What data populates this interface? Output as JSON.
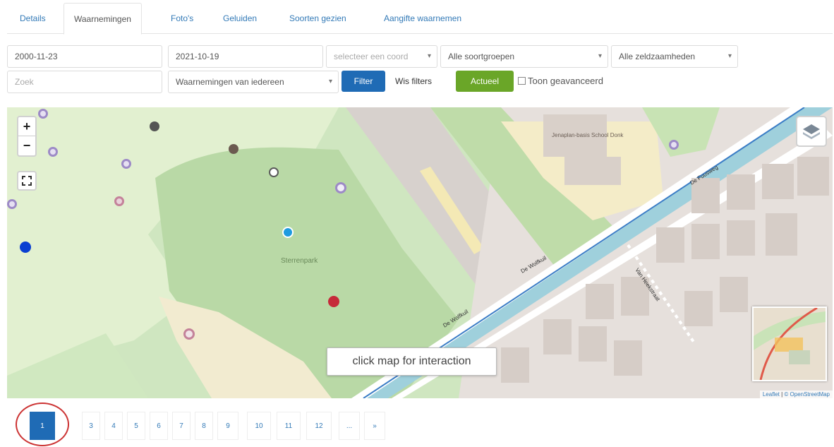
{
  "tabs": [
    {
      "label": "Details"
    },
    {
      "label": "Waarnemingen"
    },
    {
      "label": "Foto's"
    },
    {
      "label": "Geluiden"
    },
    {
      "label": "Soorten gezien"
    },
    {
      "label": "Aangifte waarnemen"
    }
  ],
  "filters": {
    "date_from": "2000-11-23",
    "date_to": "2021-10-19",
    "coord_placeholder": "selecteer een coord",
    "species_group": "Alle soortgroepen",
    "rarity": "Alle zeldzaamheden",
    "search_placeholder": "Zoek",
    "observer": "Waarnemingen van iedereen",
    "filter_label": "Filter",
    "clear_label": "Wis filters",
    "active_label": "Actueel",
    "advanced_label": "Toon geavanceerd"
  },
  "map": {
    "zoom_in": "+",
    "zoom_out": "−",
    "tooltip": "click map for interaction",
    "attribution_leaflet": "Leaflet",
    "attribution_osm": "© OpenStreetMap",
    "labels": {
      "park": "Sterrenpark",
      "school": "Jenaplan-basis School Donk",
      "road_main": "De Wolfkuil",
      "road_side": "De Fuusweg",
      "road_path": "Van Heekstraat",
      "road_bottom": "De Wolfkuil"
    },
    "icon_names": {
      "zoom_in": "plus-icon",
      "zoom_out": "minus-icon",
      "fullscreen": "fullscreen-icon",
      "layers": "layers-icon"
    },
    "marker_colors": {
      "blue": "#0a3fd1",
      "cyan": "#1e9be0",
      "red": "#c62a3a",
      "dark": "#555555",
      "purple": "#9d8ac7",
      "pink": "#c4829a"
    }
  },
  "pagination": {
    "pages": [
      "1",
      "3",
      "4",
      "5",
      "6",
      "7",
      "8",
      "9",
      "10",
      "11",
      "12",
      "...",
      "»"
    ],
    "active": "1"
  }
}
